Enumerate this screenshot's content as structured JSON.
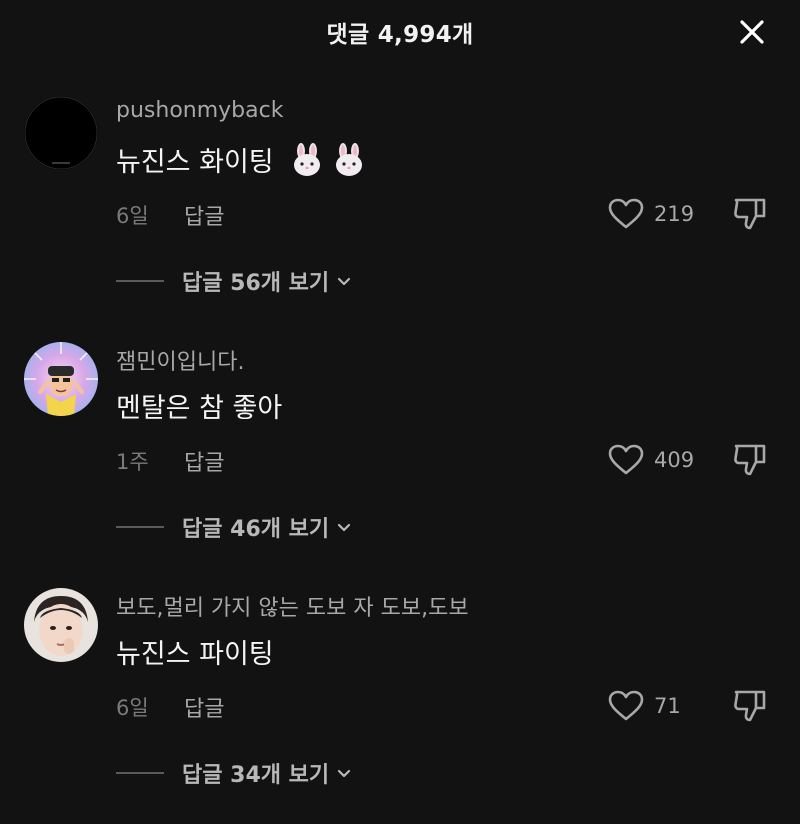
{
  "header": {
    "title": "댓글 4,994개"
  },
  "comments": [
    {
      "username": "pushonmyback",
      "text": "뉴진스 화이팅",
      "date": "6일",
      "reply_label": "답글",
      "likes": "219",
      "view_replies": "답글 56개 보기"
    },
    {
      "username": "잼민이입니다.",
      "text": "멘탈은 참 좋아",
      "date": "1주",
      "reply_label": "답글",
      "likes": "409",
      "view_replies": "답글 46개 보기"
    },
    {
      "username": "보도,멀리 가지 않는 도보 자 도보,도보",
      "text": "뉴진스 파이팅",
      "date": "6일",
      "reply_label": "답글",
      "likes": "71",
      "view_replies": "답글 34개 보기"
    }
  ],
  "icons": {
    "close": "close-icon",
    "like": "heart-icon",
    "dislike": "thumbs-down-icon",
    "chevron": "chevron-down-icon",
    "emoji": "rabbit-face-emoji"
  }
}
